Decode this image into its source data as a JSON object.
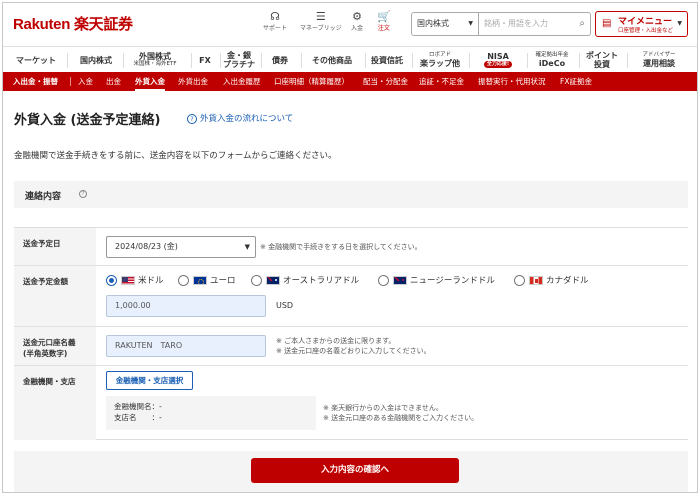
{
  "header": {
    "logo": "Rakuten 楽天証券",
    "icons": [
      {
        "icon": "support-icon",
        "label": "サポート"
      },
      {
        "icon": "money-bridge-icon",
        "label": "マネーブリッジ"
      },
      {
        "icon": "deposit-icon",
        "label": "入金"
      },
      {
        "icon": "cart-icon",
        "label": "注文"
      }
    ],
    "market_select": "国内株式",
    "search_placeholder": "銘柄・用語を入力",
    "mymenu": {
      "title": "マイメニュー",
      "sub": "口座管理・入出金など"
    }
  },
  "nav": {
    "items": [
      {
        "label": "マーケット",
        "sub": ""
      },
      {
        "label": "国内株式",
        "sub": ""
      },
      {
        "label": "外国株式",
        "sub": "米国株・海外ETF"
      },
      {
        "label": "FX",
        "sub": ""
      },
      {
        "label": "金・銀",
        "sub": "プラチナ"
      },
      {
        "label": "債券",
        "sub": ""
      },
      {
        "label": "その他商品",
        "sub": ""
      },
      {
        "label": "投資信託",
        "sub": ""
      },
      {
        "label": "ロボアド",
        "sub": "楽ラップ他"
      },
      {
        "label": "NISA",
        "sub": "全力応援!"
      },
      {
        "label": "確定拠出年金",
        "sub": "iDeCo"
      },
      {
        "label": "ポイント",
        "sub": "投資"
      },
      {
        "label": "アドバイザー",
        "sub": "運用相談"
      }
    ]
  },
  "subnav": {
    "section": "入出金・振替",
    "items": [
      "入金",
      "出金",
      "外貨入金",
      "外貨出金",
      "入出金履歴",
      "口座明細（精算履歴）",
      "配当・分配金",
      "追証・不足金",
      "振替実行・代用状況",
      "FX証拠金"
    ]
  },
  "page": {
    "title": "外貨入金 (送金予定連絡)",
    "help_link": "外貨入金の流れについて",
    "intro": "金融機関で送金手続きをする前に、送金内容を以下のフォームからご連絡ください。"
  },
  "section": {
    "title": "連絡内容"
  },
  "form": {
    "date": {
      "label": "送金予定日",
      "value": "2024/08/23 (金)",
      "note": "※ 金融機関で手続きをする日を選択してください。"
    },
    "amount": {
      "label": "送金予定金額",
      "currencies": [
        {
          "flag": "us",
          "label": "米ドル",
          "selected": true
        },
        {
          "flag": "eu",
          "label": "ユーロ",
          "selected": false
        },
        {
          "flag": "au",
          "label": "オーストラリアドル",
          "selected": false
        },
        {
          "flag": "nz",
          "label": "ニュージーランドドル",
          "selected": false
        },
        {
          "flag": "ca",
          "label": "カナダドル",
          "selected": false
        }
      ],
      "placeholder": "1,000.00",
      "unit": "USD"
    },
    "name": {
      "label_line1": "送金元口座名義",
      "label_line2": "(半角英数字)",
      "value": "RAKUTEN　TARO",
      "note1": "※ ご本人さまからの送金に限ります。",
      "note2": "※ 送金元口座の名義どおりに入力してください。"
    },
    "bank": {
      "label": "金融機関・支店",
      "button": "金融機関・支店選択",
      "bank_name": "金融機関名：-",
      "branch_name": "支店名　　：-",
      "note1": "※ 楽天銀行からの入金はできません。",
      "note2": "※ 送金元口座のある金融機関をご入力ください。"
    }
  },
  "submit": "入力内容の確認へ"
}
